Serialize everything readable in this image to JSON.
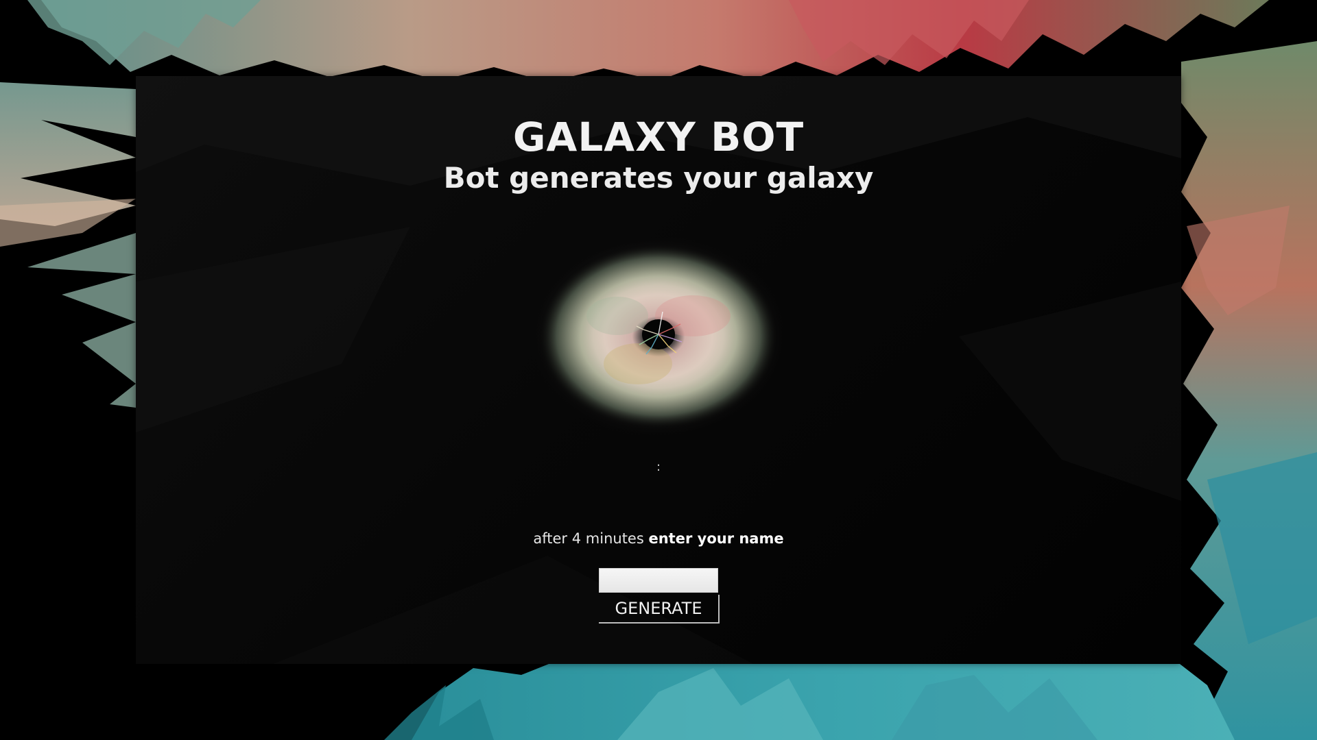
{
  "app": {
    "title": "GALAXY BOT",
    "subtitle": "Bot generates your galaxy"
  },
  "timer": {
    "text": ":"
  },
  "instruction": {
    "prefix": "after 4 minutes",
    "emphasis": "enter your name"
  },
  "form": {
    "name_value": "",
    "generate_label": "GENERATE"
  },
  "colors": {
    "panel": "#0a0a0a",
    "text": "#f2f2f2",
    "accent_red": "#c23c46",
    "accent_teal": "#3aa6b0",
    "accent_peach": "#d9a58a"
  },
  "icons": {
    "galaxy": "galaxy-image"
  }
}
